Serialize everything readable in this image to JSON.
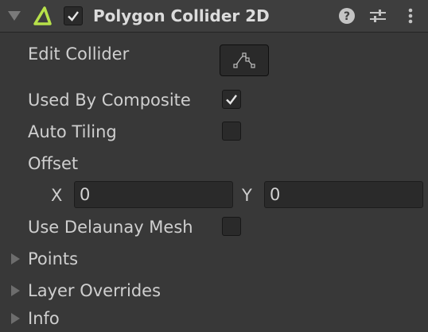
{
  "component": {
    "title": "Polygon Collider 2D",
    "enabled": true
  },
  "header_icons": [
    "polygon-collider-icon",
    "help-icon",
    "preset-sliders-icon",
    "kebab-menu-icon"
  ],
  "fields": {
    "edit_collider_label": "Edit Collider",
    "used_by_composite_label": "Used By Composite",
    "used_by_composite": true,
    "auto_tiling_label": "Auto Tiling",
    "auto_tiling": false,
    "offset_label": "Offset",
    "offset_x_label": "X",
    "offset_x_value": "0",
    "offset_y_label": "Y",
    "offset_y_value": "0",
    "use_delaunay_mesh_label": "Use Delaunay Mesh",
    "use_delaunay_mesh": false
  },
  "foldouts": {
    "points_label": "Points",
    "layer_overrides_label": "Layer Overrides",
    "info_label": "Info"
  },
  "colors": {
    "background": "#383838",
    "header": "#3e3e3e",
    "field_bg": "#2a2a2a",
    "text": "#d2d2d2",
    "accent_icon": "#b7e14a"
  }
}
